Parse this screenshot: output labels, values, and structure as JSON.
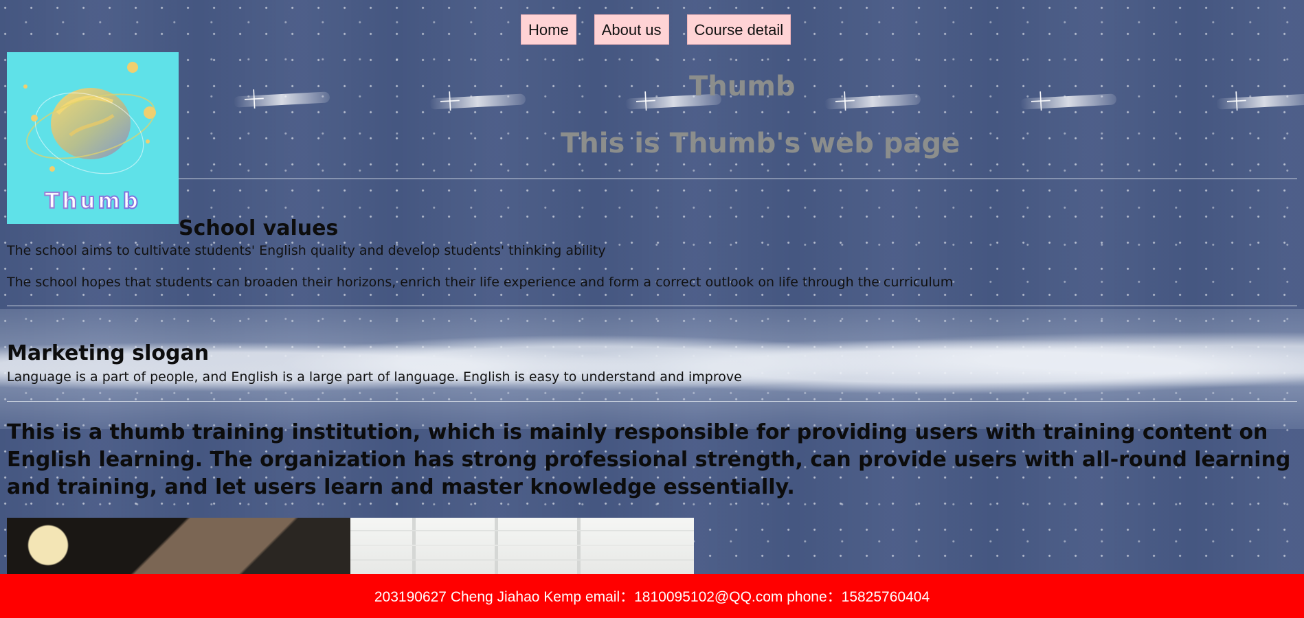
{
  "nav": {
    "items": [
      {
        "label": "Home"
      },
      {
        "label": "About us"
      },
      {
        "label": "Course detail"
      }
    ]
  },
  "logo": {
    "text": "Thumb",
    "icon": "planet-logo-icon"
  },
  "hero": {
    "title": "Thumb",
    "subtitle": "This is Thumb's web page"
  },
  "school_values": {
    "heading": "School values",
    "paragraphs": [
      "The school aims to cultivate students' English quality and develop students' thinking ability",
      "The school hopes that students can broaden their horizons, enrich their life experience and form a correct outlook on life through the curriculum"
    ]
  },
  "marketing": {
    "heading": "Marketing slogan",
    "text": "Language is a part of people, and English is a large part of language. English is easy to understand and improve"
  },
  "intro": {
    "text": "This is a thumb training institution, which is mainly responsible for providing users with training content on English learning. The organization has strong professional strength, can provide users with all-round learning and training, and let users learn and master knowledge essentially."
  },
  "footer": {
    "text": "203190627 Cheng Jiahao Kemp email：1810095102@QQ.com phone：15825760404"
  },
  "colors": {
    "nav_button": "#ffd3d5",
    "logo_background": "#5fe1e8",
    "hero_text": "#8c8e8c",
    "footer_background": "#ff0000"
  }
}
